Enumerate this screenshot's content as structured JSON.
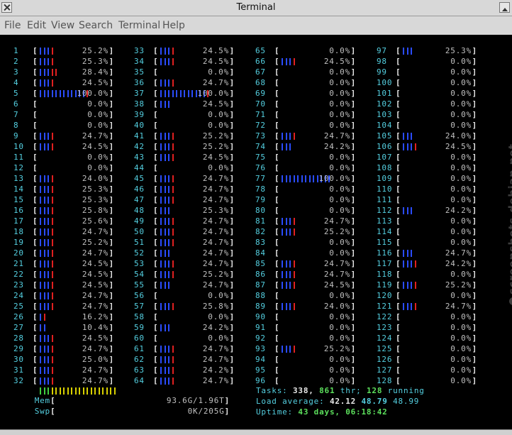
{
  "window": {
    "title": "Terminal"
  },
  "menu": [
    "File",
    "Edit",
    "View",
    "Search",
    "Terminal",
    "Help"
  ],
  "colors": {
    "bar_blue": "#2a4cff",
    "bar_red": "#e02020",
    "bar_green": "#40d040",
    "bar_yellow": "#d8d000",
    "cyan": "#54cfe0"
  },
  "cpus": [
    {
      "n": "1",
      "pct": "25.2%",
      "bar": [
        "b",
        "b",
        "b",
        "r"
      ]
    },
    {
      "n": "2",
      "pct": "25.3%",
      "bar": [
        "b",
        "b",
        "b",
        "r"
      ]
    },
    {
      "n": "3",
      "pct": "28.4%",
      "bar": [
        "b",
        "b",
        "b",
        "r",
        "r"
      ]
    },
    {
      "n": "4",
      "pct": "24.5%",
      "bar": [
        "b",
        "b",
        "b",
        "r"
      ]
    },
    {
      "n": "5",
      "pct": "100.0%",
      "bar": [
        "b",
        "b",
        "b",
        "b",
        "b",
        "b",
        "b",
        "b",
        "b",
        "b",
        "b",
        "b",
        "r"
      ]
    },
    {
      "n": "6",
      "pct": "0.0%",
      "bar": []
    },
    {
      "n": "7",
      "pct": "0.0%",
      "bar": []
    },
    {
      "n": "8",
      "pct": "0.0%",
      "bar": []
    },
    {
      "n": "9",
      "pct": "24.7%",
      "bar": [
        "b",
        "b",
        "b",
        "r"
      ]
    },
    {
      "n": "10",
      "pct": "24.5%",
      "bar": [
        "b",
        "b",
        "b",
        "r"
      ]
    },
    {
      "n": "11",
      "pct": "0.0%",
      "bar": []
    },
    {
      "n": "12",
      "pct": "0.0%",
      "bar": []
    },
    {
      "n": "13",
      "pct": "24.0%",
      "bar": [
        "b",
        "b",
        "b",
        "r"
      ]
    },
    {
      "n": "14",
      "pct": "25.3%",
      "bar": [
        "b",
        "b",
        "b",
        "r"
      ]
    },
    {
      "n": "15",
      "pct": "25.3%",
      "bar": [
        "b",
        "b",
        "b",
        "r"
      ]
    },
    {
      "n": "16",
      "pct": "25.8%",
      "bar": [
        "b",
        "b",
        "b",
        "r"
      ]
    },
    {
      "n": "17",
      "pct": "25.6%",
      "bar": [
        "b",
        "b",
        "b",
        "r"
      ]
    },
    {
      "n": "18",
      "pct": "24.7%",
      "bar": [
        "b",
        "b",
        "b",
        "r"
      ]
    },
    {
      "n": "19",
      "pct": "25.2%",
      "bar": [
        "b",
        "b",
        "b",
        "r"
      ]
    },
    {
      "n": "20",
      "pct": "24.7%",
      "bar": [
        "b",
        "b",
        "b",
        "r"
      ]
    },
    {
      "n": "21",
      "pct": "24.5%",
      "bar": [
        "b",
        "b",
        "b",
        "r"
      ]
    },
    {
      "n": "22",
      "pct": "24.5%",
      "bar": [
        "b",
        "b",
        "b",
        "r"
      ]
    },
    {
      "n": "23",
      "pct": "24.5%",
      "bar": [
        "b",
        "b",
        "b",
        "r"
      ]
    },
    {
      "n": "24",
      "pct": "24.7%",
      "bar": [
        "b",
        "b",
        "b",
        "r"
      ]
    },
    {
      "n": "25",
      "pct": "24.7%",
      "bar": [
        "b",
        "b",
        "b",
        "r"
      ]
    },
    {
      "n": "26",
      "pct": "16.2%",
      "bar": [
        "b",
        "r"
      ]
    },
    {
      "n": "27",
      "pct": "10.4%",
      "bar": [
        "b",
        "b"
      ]
    },
    {
      "n": "28",
      "pct": "24.5%",
      "bar": [
        "b",
        "b",
        "b",
        "r"
      ]
    },
    {
      "n": "29",
      "pct": "24.7%",
      "bar": [
        "b",
        "b",
        "b",
        "r"
      ]
    },
    {
      "n": "30",
      "pct": "25.0%",
      "bar": [
        "b",
        "b",
        "b",
        "r"
      ]
    },
    {
      "n": "31",
      "pct": "24.7%",
      "bar": [
        "b",
        "b",
        "b",
        "r"
      ]
    },
    {
      "n": "32",
      "pct": "24.7%",
      "bar": [
        "b",
        "b",
        "b",
        "r"
      ]
    },
    {
      "n": "33",
      "pct": "24.5%",
      "bar": [
        "b",
        "b",
        "b",
        "r"
      ]
    },
    {
      "n": "34",
      "pct": "24.5%",
      "bar": [
        "b",
        "b",
        "b",
        "r"
      ]
    },
    {
      "n": "35",
      "pct": "0.0%",
      "bar": []
    },
    {
      "n": "36",
      "pct": "24.7%",
      "bar": [
        "b",
        "b",
        "b",
        "r"
      ]
    },
    {
      "n": "37",
      "pct": "100.0%",
      "bar": [
        "b",
        "b",
        "b",
        "b",
        "b",
        "b",
        "b",
        "b",
        "b",
        "b",
        "b",
        "b",
        "r"
      ]
    },
    {
      "n": "38",
      "pct": "24.5%",
      "bar": [
        "b",
        "b",
        "b"
      ]
    },
    {
      "n": "39",
      "pct": "0.0%",
      "bar": []
    },
    {
      "n": "40",
      "pct": "0.0%",
      "bar": []
    },
    {
      "n": "41",
      "pct": "25.2%",
      "bar": [
        "b",
        "b",
        "b",
        "r"
      ]
    },
    {
      "n": "42",
      "pct": "25.2%",
      "bar": [
        "b",
        "b",
        "b",
        "r"
      ]
    },
    {
      "n": "43",
      "pct": "24.5%",
      "bar": [
        "b",
        "b",
        "b",
        "r"
      ]
    },
    {
      "n": "44",
      "pct": "0.0%",
      "bar": []
    },
    {
      "n": "45",
      "pct": "24.7%",
      "bar": [
        "b",
        "b",
        "b",
        "r"
      ]
    },
    {
      "n": "46",
      "pct": "24.7%",
      "bar": [
        "b",
        "b",
        "b",
        "r"
      ]
    },
    {
      "n": "47",
      "pct": "24.7%",
      "bar": [
        "b",
        "b",
        "b",
        "r"
      ]
    },
    {
      "n": "48",
      "pct": "25.3%",
      "bar": [
        "b",
        "b",
        "b"
      ]
    },
    {
      "n": "49",
      "pct": "24.7%",
      "bar": [
        "b",
        "b",
        "b",
        "r"
      ]
    },
    {
      "n": "50",
      "pct": "24.7%",
      "bar": [
        "b",
        "b",
        "b",
        "r"
      ]
    },
    {
      "n": "51",
      "pct": "24.7%",
      "bar": [
        "b",
        "b",
        "b",
        "r"
      ]
    },
    {
      "n": "52",
      "pct": "24.7%",
      "bar": [
        "b",
        "b",
        "b"
      ]
    },
    {
      "n": "53",
      "pct": "24.7%",
      "bar": [
        "b",
        "b",
        "b",
        "r"
      ]
    },
    {
      "n": "54",
      "pct": "25.2%",
      "bar": [
        "b",
        "b",
        "b",
        "r"
      ]
    },
    {
      "n": "55",
      "pct": "24.7%",
      "bar": [
        "b",
        "b",
        "b"
      ]
    },
    {
      "n": "56",
      "pct": "0.0%",
      "bar": []
    },
    {
      "n": "57",
      "pct": "25.8%",
      "bar": [
        "b",
        "b",
        "b",
        "r"
      ]
    },
    {
      "n": "58",
      "pct": "0.0%",
      "bar": []
    },
    {
      "n": "59",
      "pct": "24.2%",
      "bar": [
        "b",
        "b",
        "b"
      ]
    },
    {
      "n": "60",
      "pct": "0.0%",
      "bar": []
    },
    {
      "n": "61",
      "pct": "24.7%",
      "bar": [
        "b",
        "b",
        "b",
        "r"
      ]
    },
    {
      "n": "62",
      "pct": "24.7%",
      "bar": [
        "b",
        "b",
        "b",
        "r"
      ]
    },
    {
      "n": "63",
      "pct": "24.2%",
      "bar": [
        "b",
        "b",
        "b",
        "r"
      ]
    },
    {
      "n": "64",
      "pct": "24.7%",
      "bar": [
        "b",
        "b",
        "b",
        "r"
      ]
    },
    {
      "n": "65",
      "pct": "0.0%",
      "bar": []
    },
    {
      "n": "66",
      "pct": "24.5%",
      "bar": [
        "b",
        "b",
        "b",
        "r"
      ]
    },
    {
      "n": "67",
      "pct": "0.0%",
      "bar": []
    },
    {
      "n": "68",
      "pct": "0.0%",
      "bar": []
    },
    {
      "n": "69",
      "pct": "0.0%",
      "bar": []
    },
    {
      "n": "70",
      "pct": "0.0%",
      "bar": []
    },
    {
      "n": "71",
      "pct": "0.0%",
      "bar": []
    },
    {
      "n": "72",
      "pct": "0.0%",
      "bar": []
    },
    {
      "n": "73",
      "pct": "24.7%",
      "bar": [
        "b",
        "b",
        "b",
        "r"
      ]
    },
    {
      "n": "74",
      "pct": "24.2%",
      "bar": [
        "b",
        "b",
        "b"
      ]
    },
    {
      "n": "75",
      "pct": "0.0%",
      "bar": []
    },
    {
      "n": "76",
      "pct": "0.0%",
      "bar": []
    },
    {
      "n": "77",
      "pct": "100.0%",
      "bar": [
        "b",
        "b",
        "b",
        "b",
        "b",
        "b",
        "b",
        "b",
        "b",
        "b",
        "b",
        "b",
        "b"
      ]
    },
    {
      "n": "78",
      "pct": "0.0%",
      "bar": []
    },
    {
      "n": "79",
      "pct": "0.0%",
      "bar": []
    },
    {
      "n": "80",
      "pct": "0.0%",
      "bar": []
    },
    {
      "n": "81",
      "pct": "24.7%",
      "bar": [
        "b",
        "b",
        "b",
        "r"
      ]
    },
    {
      "n": "82",
      "pct": "25.2%",
      "bar": [
        "b",
        "b",
        "b",
        "r"
      ]
    },
    {
      "n": "83",
      "pct": "0.0%",
      "bar": []
    },
    {
      "n": "84",
      "pct": "0.0%",
      "bar": []
    },
    {
      "n": "85",
      "pct": "24.7%",
      "bar": [
        "b",
        "b",
        "b",
        "r"
      ]
    },
    {
      "n": "86",
      "pct": "24.7%",
      "bar": [
        "b",
        "b",
        "b",
        "r"
      ]
    },
    {
      "n": "87",
      "pct": "24.5%",
      "bar": [
        "b",
        "b",
        "b",
        "r"
      ]
    },
    {
      "n": "88",
      "pct": "0.0%",
      "bar": []
    },
    {
      "n": "89",
      "pct": "24.0%",
      "bar": [
        "b",
        "b",
        "b",
        "r"
      ]
    },
    {
      "n": "90",
      "pct": "0.0%",
      "bar": []
    },
    {
      "n": "91",
      "pct": "0.0%",
      "bar": []
    },
    {
      "n": "92",
      "pct": "0.0%",
      "bar": []
    },
    {
      "n": "93",
      "pct": "25.2%",
      "bar": [
        "b",
        "b",
        "b",
        "r"
      ]
    },
    {
      "n": "94",
      "pct": "0.0%",
      "bar": []
    },
    {
      "n": "95",
      "pct": "0.0%",
      "bar": []
    },
    {
      "n": "96",
      "pct": "0.0%",
      "bar": []
    },
    {
      "n": "97",
      "pct": "25.3%",
      "bar": [
        "b",
        "b",
        "b"
      ]
    },
    {
      "n": "98",
      "pct": "0.0%",
      "bar": []
    },
    {
      "n": "99",
      "pct": "0.0%",
      "bar": []
    },
    {
      "n": "100",
      "pct": "0.0%",
      "bar": []
    },
    {
      "n": "101",
      "pct": "0.0%",
      "bar": []
    },
    {
      "n": "102",
      "pct": "0.0%",
      "bar": []
    },
    {
      "n": "103",
      "pct": "0.0%",
      "bar": []
    },
    {
      "n": "104",
      "pct": "0.0%",
      "bar": []
    },
    {
      "n": "105",
      "pct": "24.0%",
      "bar": [
        "b",
        "b",
        "b"
      ]
    },
    {
      "n": "106",
      "pct": "24.5%",
      "bar": [
        "b",
        "b",
        "b",
        "r"
      ]
    },
    {
      "n": "107",
      "pct": "0.0%",
      "bar": []
    },
    {
      "n": "108",
      "pct": "0.0%",
      "bar": []
    },
    {
      "n": "109",
      "pct": "0.0%",
      "bar": []
    },
    {
      "n": "110",
      "pct": "0.0%",
      "bar": []
    },
    {
      "n": "111",
      "pct": "0.0%",
      "bar": []
    },
    {
      "n": "112",
      "pct": "24.2%",
      "bar": [
        "b",
        "b",
        "b"
      ]
    },
    {
      "n": "113",
      "pct": "0.0%",
      "bar": []
    },
    {
      "n": "114",
      "pct": "0.0%",
      "bar": []
    },
    {
      "n": "115",
      "pct": "0.0%",
      "bar": []
    },
    {
      "n": "116",
      "pct": "24.7%",
      "bar": [
        "b",
        "b",
        "b"
      ]
    },
    {
      "n": "117",
      "pct": "24.2%",
      "bar": [
        "b",
        "b",
        "b",
        "r"
      ]
    },
    {
      "n": "118",
      "pct": "0.0%",
      "bar": []
    },
    {
      "n": "119",
      "pct": "25.2%",
      "bar": [
        "b",
        "b",
        "b",
        "r"
      ]
    },
    {
      "n": "120",
      "pct": "0.0%",
      "bar": []
    },
    {
      "n": "121",
      "pct": "24.7%",
      "bar": [
        "b",
        "b",
        "b",
        "r"
      ]
    },
    {
      "n": "122",
      "pct": "0.0%",
      "bar": []
    },
    {
      "n": "123",
      "pct": "0.0%",
      "bar": []
    },
    {
      "n": "124",
      "pct": "0.0%",
      "bar": []
    },
    {
      "n": "125",
      "pct": "0.0%",
      "bar": []
    },
    {
      "n": "126",
      "pct": "0.0%",
      "bar": []
    },
    {
      "n": "127",
      "pct": "0.0%",
      "bar": []
    },
    {
      "n": "128",
      "pct": "0.0%",
      "bar": []
    }
  ],
  "mem": {
    "label": "Mem",
    "value": "93.6G/1.96T",
    "bar": [
      "g",
      "g",
      "g",
      "y",
      "y",
      "y",
      "y",
      "y",
      "y",
      "y",
      "y",
      "y",
      "y",
      "y",
      "y",
      "y",
      "y",
      "y",
      "y",
      "y"
    ]
  },
  "swp": {
    "label": "Swp",
    "value": "0K/205G"
  },
  "tasks": {
    "label": "Tasks:",
    "count": "338,",
    "thr": "861",
    "thr_label": "thr;",
    "running": "128",
    "running_label": "running"
  },
  "load": {
    "label": "Load average:",
    "v1": "42.12",
    "v5": "48.79",
    "v15": "48.99"
  },
  "uptime": {
    "label": "Uptime:",
    "value": "43 days, 06:18:42"
  },
  "watermark": "screenshots.debian.net"
}
